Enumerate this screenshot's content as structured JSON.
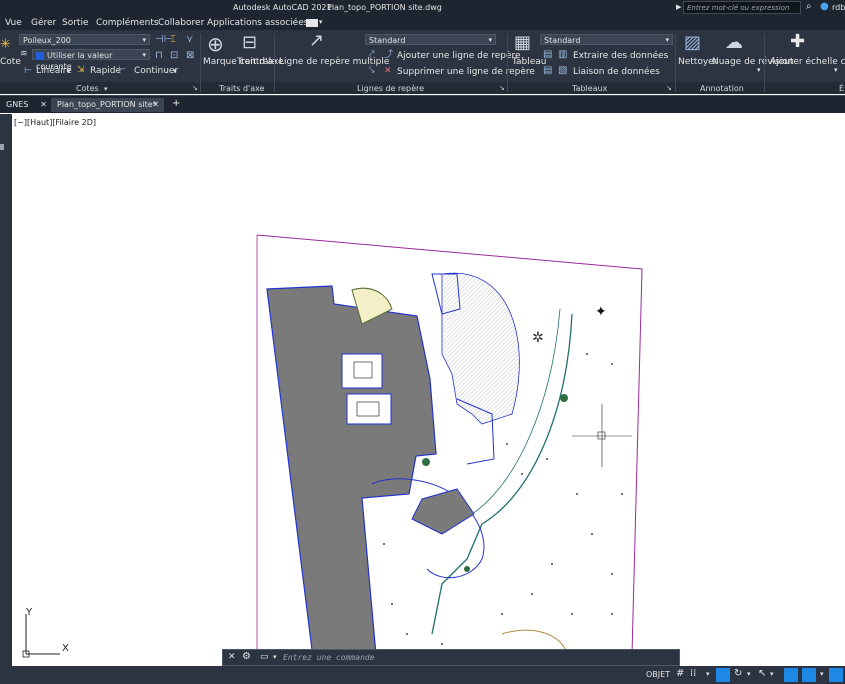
{
  "title_bar": {
    "app": "Autodesk AutoCAD 2021",
    "document": "Plan_topo_PORTION site.dwg",
    "search_placeholder": "Entrez mot-clé ou expression",
    "user": "rdb"
  },
  "menu": [
    "Vue",
    "Gérer",
    "Sortie",
    "Compléments",
    "Collaborer",
    "Applications associées"
  ],
  "ribbon": {
    "cotes": {
      "cote_label": "Cote",
      "dim_style": "Poileux_200",
      "current_value": "Utiliser la valeur courante",
      "lineaire": "Linéaire",
      "rapide": "Rapide",
      "continuer": "Continuer",
      "group": "Cotes"
    },
    "traits_axe": {
      "marque": "Marque centrale",
      "trait": "Trait d'axe",
      "group": "Traits d'axe"
    },
    "lignes_repere": {
      "multiple": "Ligne de repère multiple",
      "style": "Standard",
      "ajouter": "Ajouter une ligne de repère",
      "supprimer": "Supprimer une ligne de repère",
      "group": "Lignes de repère"
    },
    "tableaux": {
      "tableau": "Tableau",
      "style": "Standard",
      "extraire": "Extraire des données",
      "liaison": "Liaison de données",
      "group": "Tableaux"
    },
    "annotation": {
      "nettoyer": "Nettoyer",
      "nuage": "Nuage de révision",
      "group": "Annotation"
    },
    "echelle": {
      "ajouter": "Ajouter échelle courante",
      "group": "É"
    }
  },
  "tabs": [
    {
      "label": "GNES 3D*",
      "active": false
    },
    {
      "label": "Plan_topo_PORTION site*",
      "active": true
    }
  ],
  "viewport": {
    "label": "[−][Haut][Filaire 2D]",
    "ucs_x": "X",
    "ucs_y": "Y"
  },
  "command": {
    "placeholder": "Entrez une commande"
  },
  "status": {
    "model": "OBJET"
  },
  "colors": {
    "chrome": "#2b3440",
    "accent": "#1e88e5",
    "building": "#7a7a7a",
    "boundary": "#9b2a9b"
  }
}
